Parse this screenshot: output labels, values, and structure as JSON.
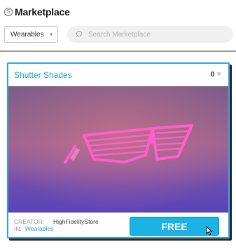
{
  "header": {
    "title": "Marketplace",
    "coin_icon": "coin-icon"
  },
  "filter": {
    "selected": "Wearables"
  },
  "search": {
    "placeholder": "Search Marketplace",
    "icon": "search-icon"
  },
  "item": {
    "name": "Shutter Shades",
    "likes": "0",
    "creator_label": "CREATOR:",
    "creator": "HighFidelityStore",
    "category_label": "IN:",
    "category": "Wearables",
    "price_label": "FREE",
    "glasses_color": "#ff5fc8"
  },
  "colors": {
    "accent": "#1fa3dc",
    "button": "#1bb3e6"
  }
}
